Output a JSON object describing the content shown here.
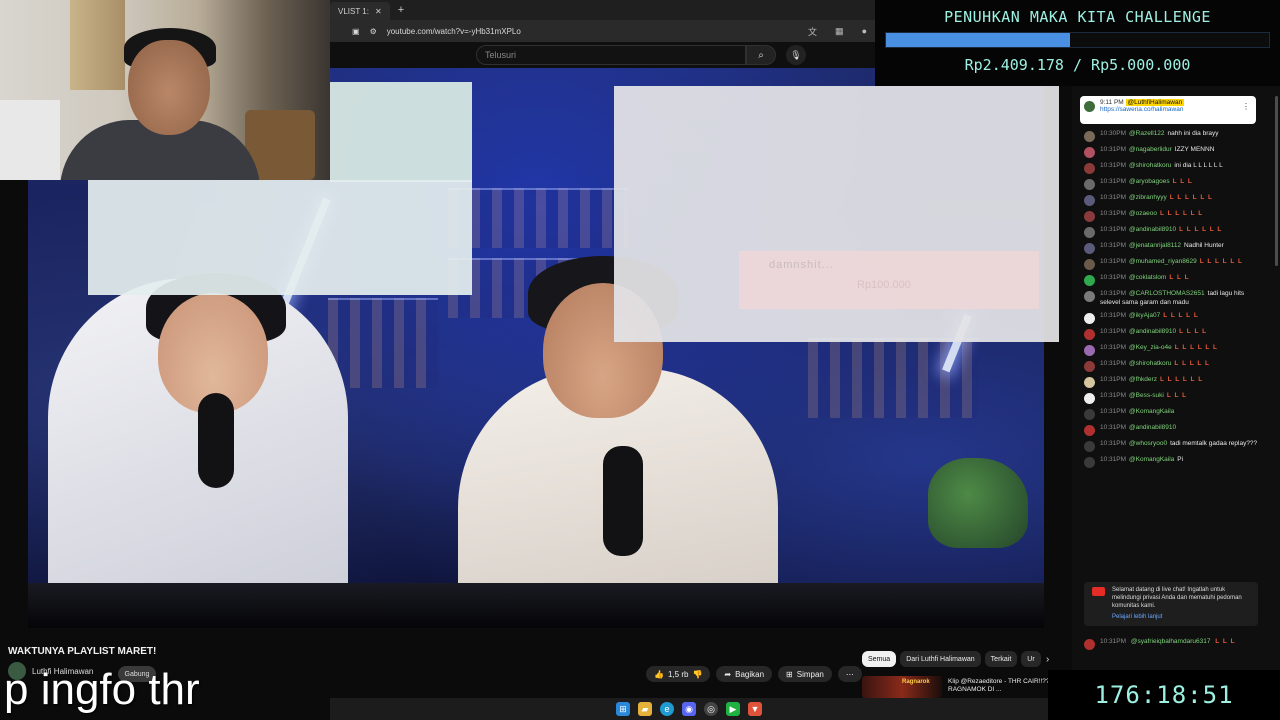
{
  "browser": {
    "tab_title": "VLIST 1:",
    "url": "youtube.com/watch?v=-yHb31mXPLo"
  },
  "yt_header": {
    "search_placeholder": "Telusuri"
  },
  "goal": {
    "title": "PENUHKAN MAKA KITA CHALLENGE",
    "amount_text": "Rp2.409.178 / Rp5.000.000",
    "progress": 0.48,
    "bar_color": "#4a90e2",
    "text_color": "#9ef0e2"
  },
  "overlay_alert": {
    "name": "damnshit...",
    "amount": "Rp100.000"
  },
  "pinned": {
    "time": "9:11 PM",
    "author": "@LuthfiHalimawan",
    "link": "https://saweria.co/halimawan"
  },
  "chat": [
    {
      "time": "10:30PM",
      "author": "@Razell122",
      "text": "nahh ini dia brayy",
      "avatar": "#7a6a5a"
    },
    {
      "time": "10:31PM",
      "author": "@nagaberlidur",
      "text": "IZZY MENNN",
      "avatar": "#b05060"
    },
    {
      "time": "10:31PM",
      "author": "@shirohatkoru",
      "text": "ini dia L L L L L L",
      "avatar": "#8b3a3a"
    },
    {
      "time": "10:31PM",
      "author": "@aryobagoes",
      "text": "L L L",
      "avatar": "#6a6a6a"
    },
    {
      "time": "10:31PM",
      "author": "@zibranhyyy",
      "text": "L L L L L L",
      "avatar": "#5a5a7a"
    },
    {
      "time": "10:31PM",
      "author": "@ozaeoo",
      "text": "L L L L L L",
      "avatar": "#8a3a3a"
    },
    {
      "time": "10:31PM",
      "author": "@andinabil8910",
      "text": "L L L L L L",
      "avatar": "#6a6a6a"
    },
    {
      "time": "10:31PM",
      "author": "@jenatanrijal8112",
      "text": "Nadhil Hunter",
      "avatar": "#5a5a7a"
    },
    {
      "time": "10:31PM",
      "author": "@muhamed_riyan8629",
      "text": "L L L L L L",
      "avatar": "#6a5a4a"
    },
    {
      "time": "10:31PM",
      "author": "@coklatslom",
      "text": "L L L",
      "avatar": "#2fa84f"
    },
    {
      "time": "10:31PM",
      "author": "@CARLOSTHOMAS2651",
      "text": "tadi lagu hits selevel sama garam dan madu",
      "avatar": "#7a7a7a"
    },
    {
      "time": "10:31PM",
      "author": "@ikyAja07",
      "text": "L L L L L",
      "avatar": "#eeeeee"
    },
    {
      "time": "10:31PM",
      "author": "@andinabil8910",
      "text": "L L L L",
      "avatar": "#b03030"
    },
    {
      "time": "10:31PM",
      "author": "@Key_zia-o4e",
      "text": "L L L L L L",
      "avatar": "#9a6ab0"
    },
    {
      "time": "10:31PM",
      "author": "@shirohatkoru",
      "text": "L L L L L",
      "avatar": "#8b3a3a"
    },
    {
      "time": "10:31PM",
      "author": "@fhkderz",
      "text": "L L L L L L",
      "avatar": "#d6c6a0"
    },
    {
      "time": "10:31PM",
      "author": "@Bess-suki",
      "text": "L L L",
      "avatar": "#eeeeee"
    },
    {
      "time": "10:31PM",
      "author": "@KomangKaila",
      "text": "",
      "avatar": "#3a3a3a"
    },
    {
      "time": "10:31PM",
      "author": "@andinabil8910",
      "text": "",
      "avatar": "#b03030"
    },
    {
      "time": "10:31PM",
      "author": "@whosryoo0",
      "text": "tadi memtalk gadaa replay???",
      "avatar": "#3a3a3a"
    },
    {
      "time": "10:31PM",
      "author": "@KomangKaila",
      "text": "Pi",
      "avatar": "#3a3a3a"
    }
  ],
  "chat_welcome": {
    "text": "Selamat datang di live chat! Ingatlah untuk melindungi privasi Anda dan mematuhi pedoman komunitas kami.",
    "learn_more": "Pelajari lebih lanjut"
  },
  "chat_last": {
    "time": "10:31PM",
    "author": "@syafrieiqbalhamdaru6317",
    "text": "L L L",
    "avatar": "#b03030"
  },
  "video": {
    "title": "WAKTUNYA PLAYLIST MARET!",
    "channel": "Luthfi Halimawan",
    "join_label": "Gabung",
    "like_count": "1,5 rb",
    "share_label": "Bagikan",
    "save_label": "Simpan"
  },
  "subtitle_text": "p ingfo thr",
  "chips": [
    "Semua",
    "Dari Luthfi Halimawan",
    "Terkait",
    "Ur"
  ],
  "related": {
    "thumb_text": "Ragnarok",
    "title": "Klip @Rezaeditore - THR CAIR!!?? TES RAGNAMOK DI ..."
  },
  "timer": "176:18:51"
}
